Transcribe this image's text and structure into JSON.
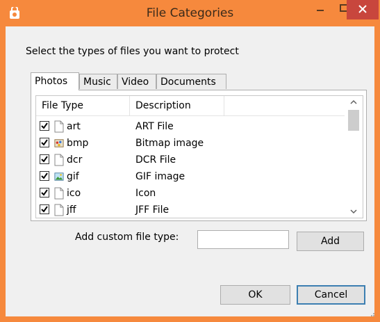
{
  "window": {
    "title": "File Categories",
    "accent_color": "#f6893d",
    "close_color": "#c8463d"
  },
  "prompt": "Select the types of files you want to protect",
  "tabs": [
    {
      "label": "Photos",
      "selected": true
    },
    {
      "label": "Music",
      "selected": false
    },
    {
      "label": "Video",
      "selected": false
    },
    {
      "label": "Documents",
      "selected": false
    }
  ],
  "list": {
    "columns": [
      "File Type",
      "Description"
    ],
    "rows": [
      {
        "ext": "art",
        "description": "ART File",
        "checked": true,
        "icon": "blank-file-icon"
      },
      {
        "ext": "bmp",
        "description": "Bitmap image",
        "checked": true,
        "icon": "paint-image-icon"
      },
      {
        "ext": "dcr",
        "description": "DCR File",
        "checked": true,
        "icon": "blank-file-icon"
      },
      {
        "ext": "gif",
        "description": "GIF image",
        "checked": true,
        "icon": "picture-image-icon"
      },
      {
        "ext": "ico",
        "description": "Icon",
        "checked": true,
        "icon": "blank-file-icon"
      },
      {
        "ext": "jff",
        "description": "JFF File",
        "checked": true,
        "icon": "blank-file-icon"
      }
    ]
  },
  "custom": {
    "label": "Add custom file type:",
    "value": "",
    "add_label": "Add"
  },
  "buttons": {
    "ok": "OK",
    "cancel": "Cancel"
  }
}
